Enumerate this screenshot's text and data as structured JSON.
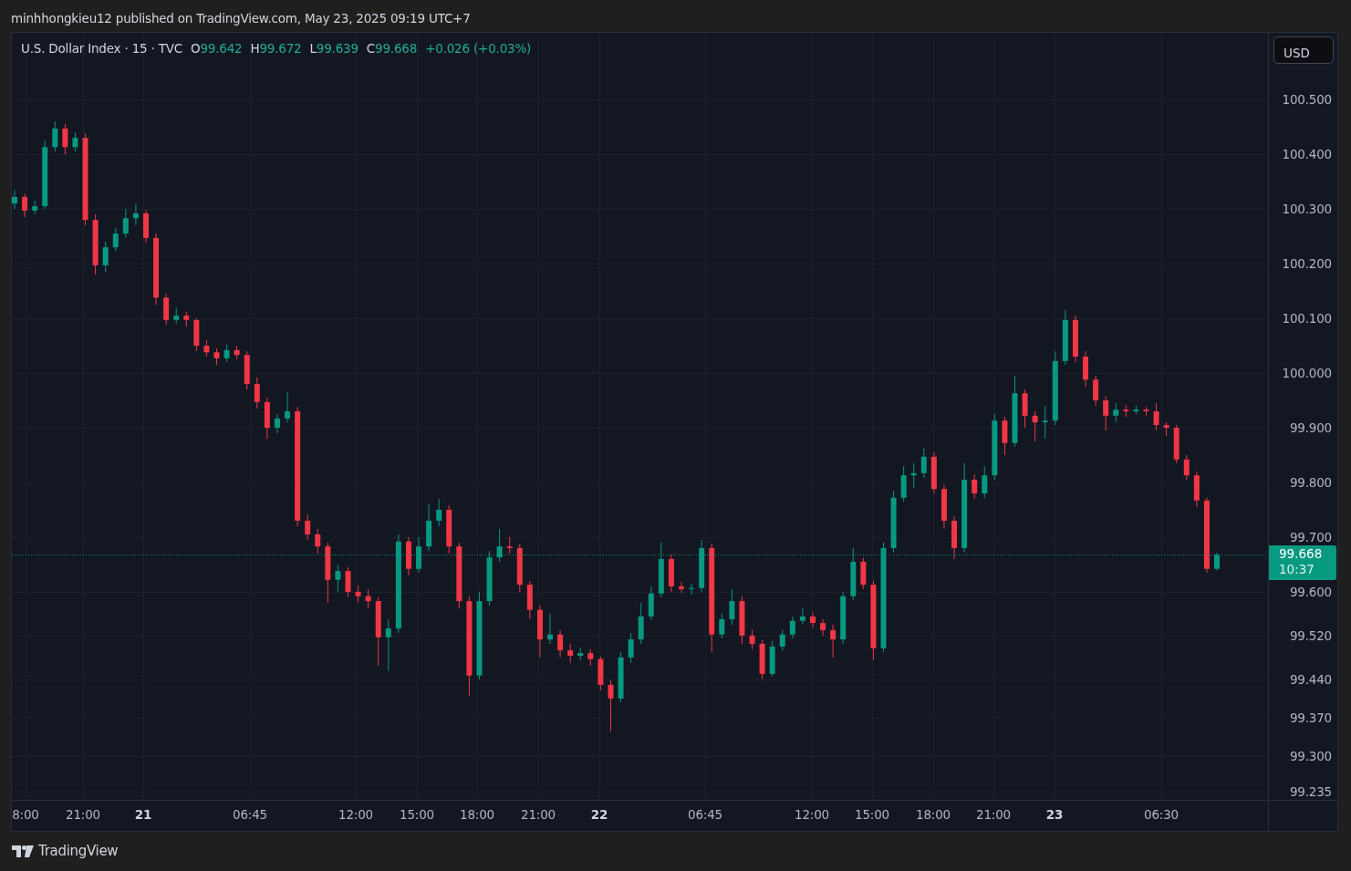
{
  "published_line": "minhhongkieu12 published on TradingView.com, May 23, 2025 09:19 UTC+7",
  "legend": {
    "symbol": "U.S. Dollar Index · 15 · TVC",
    "values": [
      {
        "label": "O",
        "value": "99.642"
      },
      {
        "label": "H",
        "value": "99.672"
      },
      {
        "label": "L",
        "value": "99.639"
      },
      {
        "label": "C",
        "value": "99.668"
      }
    ],
    "change": "+0.026 (+0.03%)"
  },
  "chart": {
    "chart_data": {
      "type": "candlestick",
      "grid": true,
      "ref_lines": [
        {
          "axis": "y",
          "value": 99.668
        }
      ],
      "ylim": [
        99.218,
        100.622
      ],
      "yticks": [
        {
          "value": 100.5,
          "label": "100.500"
        },
        {
          "value": 100.4,
          "label": "100.400"
        },
        {
          "value": 100.3,
          "label": "100.300"
        },
        {
          "value": 100.2,
          "label": "100.200"
        },
        {
          "value": 100.1,
          "label": "100.100"
        },
        {
          "value": 100.0,
          "label": "100.000"
        },
        {
          "value": 99.9,
          "label": "99.900"
        },
        {
          "value": 99.8,
          "label": "99.800"
        },
        {
          "value": 99.7,
          "label": "99.700"
        },
        {
          "value": 99.6,
          "label": "99.600"
        },
        {
          "value": 99.52,
          "label": "99.520"
        },
        {
          "value": 99.44,
          "label": "99.440"
        },
        {
          "value": 99.37,
          "label": "99.370"
        },
        {
          "value": 99.3,
          "label": "99.300"
        },
        {
          "value": 99.235,
          "label": "99.235"
        }
      ],
      "categories": [
        null,
        null,
        null,
        null,
        null,
        null,
        null,
        null,
        null,
        null,
        null,
        null,
        null,
        null,
        null,
        null,
        null,
        null,
        null,
        null,
        null,
        null,
        null,
        null,
        null,
        null,
        null,
        null,
        null,
        null,
        null,
        null,
        null,
        null,
        null,
        null,
        null,
        null,
        null,
        null,
        null,
        null,
        null,
        null,
        null,
        null,
        null,
        null,
        null,
        null,
        null,
        null,
        null,
        null,
        null,
        null,
        null,
        null,
        null,
        null,
        null,
        null,
        null,
        null,
        null,
        null,
        null,
        null,
        null,
        null,
        null,
        null,
        null,
        null,
        null,
        null,
        null,
        null,
        null,
        null,
        null,
        null,
        null,
        null,
        null,
        null,
        null,
        null,
        null,
        null,
        null,
        null,
        null,
        null,
        null,
        null,
        null,
        null,
        null,
        null,
        null,
        null,
        null,
        null,
        null,
        null,
        null,
        null,
        null,
        null,
        null,
        null,
        null,
        null,
        null,
        null,
        null,
        null,
        null,
        null
      ],
      "ohlc": [
        [
          100.31,
          100.334,
          100.3,
          100.322
        ],
        [
          100.322,
          100.328,
          100.285,
          100.297
        ],
        [
          100.297,
          100.315,
          100.29,
          100.305
        ],
        [
          100.305,
          100.425,
          100.3,
          100.413
        ],
        [
          100.413,
          100.46,
          100.405,
          100.447
        ],
        [
          100.447,
          100.455,
          100.4,
          100.413
        ],
        [
          100.413,
          100.44,
          100.405,
          100.43
        ],
        [
          100.43,
          100.438,
          100.27,
          100.28
        ],
        [
          100.28,
          100.29,
          100.18,
          100.197
        ],
        [
          100.197,
          100.24,
          100.185,
          100.23
        ],
        [
          100.23,
          100.265,
          100.222,
          100.255
        ],
        [
          100.255,
          100.3,
          100.248,
          100.283
        ],
        [
          100.283,
          100.31,
          100.27,
          100.292
        ],
        [
          100.292,
          100.298,
          100.238,
          100.247
        ],
        [
          100.247,
          100.255,
          100.125,
          100.138
        ],
        [
          100.138,
          100.145,
          100.088,
          100.097
        ],
        [
          100.097,
          100.12,
          100.09,
          100.105
        ],
        [
          100.105,
          100.112,
          100.085,
          100.097
        ],
        [
          100.097,
          100.1,
          100.04,
          100.05
        ],
        [
          100.05,
          100.06,
          100.03,
          100.038
        ],
        [
          100.038,
          100.045,
          100.015,
          100.027
        ],
        [
          100.027,
          100.052,
          100.02,
          100.042
        ],
        [
          100.042,
          100.05,
          100.025,
          100.033
        ],
        [
          100.033,
          100.04,
          99.97,
          99.98
        ],
        [
          99.98,
          99.992,
          99.935,
          99.947
        ],
        [
          99.947,
          99.955,
          99.88,
          99.9
        ],
        [
          99.9,
          99.925,
          99.89,
          99.917
        ],
        [
          99.917,
          99.965,
          99.91,
          99.93
        ],
        [
          99.93,
          99.938,
          99.72,
          99.73
        ],
        [
          99.73,
          99.742,
          99.695,
          99.705
        ],
        [
          99.705,
          99.715,
          99.67,
          99.683
        ],
        [
          99.683,
          99.69,
          99.58,
          99.622
        ],
        [
          99.622,
          99.65,
          99.6,
          99.638
        ],
        [
          99.638,
          99.645,
          99.59,
          99.6
        ],
        [
          99.6,
          99.612,
          99.58,
          99.592
        ],
        [
          99.592,
          99.605,
          99.57,
          99.583
        ],
        [
          99.583,
          99.59,
          99.465,
          99.517
        ],
        [
          99.517,
          99.55,
          99.455,
          99.533
        ],
        [
          99.533,
          99.705,
          99.525,
          99.692
        ],
        [
          99.692,
          99.7,
          99.63,
          99.642
        ],
        [
          99.642,
          99.7,
          99.635,
          99.683
        ],
        [
          99.683,
          99.76,
          99.675,
          99.73
        ],
        [
          99.73,
          99.77,
          99.72,
          99.75
        ],
        [
          99.75,
          99.758,
          99.67,
          99.683
        ],
        [
          99.683,
          99.69,
          99.57,
          99.583
        ],
        [
          99.583,
          99.592,
          99.41,
          99.447
        ],
        [
          99.447,
          99.6,
          99.44,
          99.583
        ],
        [
          99.583,
          99.675,
          99.575,
          99.663
        ],
        [
          99.663,
          99.715,
          99.655,
          99.683
        ],
        [
          99.683,
          99.7,
          99.67,
          99.68
        ],
        [
          99.68,
          99.688,
          99.6,
          99.613
        ],
        [
          99.613,
          99.62,
          99.55,
          99.567
        ],
        [
          99.567,
          99.575,
          99.48,
          99.513
        ],
        [
          99.513,
          99.56,
          99.505,
          99.522
        ],
        [
          99.522,
          99.53,
          99.48,
          99.493
        ],
        [
          99.493,
          99.505,
          99.47,
          99.483
        ],
        [
          99.483,
          99.498,
          99.475,
          99.488
        ],
        [
          99.488,
          99.495,
          99.465,
          99.477
        ],
        [
          99.477,
          99.482,
          99.42,
          99.43
        ],
        [
          99.43,
          99.438,
          99.345,
          99.405
        ],
        [
          99.405,
          99.49,
          99.398,
          99.48
        ],
        [
          99.48,
          99.525,
          99.47,
          99.513
        ],
        [
          99.513,
          99.58,
          99.505,
          99.555
        ],
        [
          99.555,
          99.61,
          99.548,
          99.597
        ],
        [
          99.597,
          99.69,
          99.59,
          99.66
        ],
        [
          99.66,
          99.668,
          99.6,
          99.61
        ],
        [
          99.61,
          99.618,
          99.598,
          99.605
        ],
        [
          99.605,
          99.615,
          99.595,
          99.607
        ],
        [
          99.607,
          99.695,
          99.6,
          99.68
        ],
        [
          99.68,
          99.688,
          99.49,
          99.522
        ],
        [
          99.522,
          99.56,
          99.515,
          99.55
        ],
        [
          99.55,
          99.605,
          99.54,
          99.583
        ],
        [
          99.583,
          99.592,
          99.505,
          99.52
        ],
        [
          99.52,
          99.53,
          99.495,
          99.505
        ],
        [
          99.505,
          99.512,
          99.44,
          99.45
        ],
        [
          99.45,
          99.51,
          99.445,
          99.5
        ],
        [
          99.5,
          99.53,
          99.492,
          99.522
        ],
        [
          99.522,
          99.555,
          99.515,
          99.547
        ],
        [
          99.547,
          99.57,
          99.54,
          99.555
        ],
        [
          99.555,
          99.562,
          99.535,
          99.543
        ],
        [
          99.543,
          99.55,
          99.52,
          99.53
        ],
        [
          99.53,
          99.54,
          99.48,
          99.513
        ],
        [
          99.513,
          99.6,
          99.505,
          99.592
        ],
        [
          99.592,
          99.68,
          99.585,
          99.655
        ],
        [
          99.655,
          99.662,
          99.605,
          99.613
        ],
        [
          99.613,
          99.62,
          99.475,
          99.497
        ],
        [
          99.497,
          99.69,
          99.49,
          99.68
        ],
        [
          99.68,
          99.785,
          99.672,
          99.772
        ],
        [
          99.772,
          99.83,
          99.765,
          99.813
        ],
        [
          99.813,
          99.835,
          99.79,
          99.817
        ],
        [
          99.817,
          99.862,
          99.808,
          99.847
        ],
        [
          99.847,
          99.855,
          99.78,
          99.788
        ],
        [
          99.788,
          99.795,
          99.715,
          99.73
        ],
        [
          99.73,
          99.738,
          99.66,
          99.68
        ],
        [
          99.68,
          99.835,
          99.672,
          99.805
        ],
        [
          99.805,
          99.815,
          99.77,
          99.78
        ],
        [
          99.78,
          99.83,
          99.772,
          99.813
        ],
        [
          99.813,
          99.925,
          99.805,
          99.913
        ],
        [
          99.913,
          99.92,
          99.85,
          99.872
        ],
        [
          99.872,
          99.995,
          99.865,
          99.963
        ],
        [
          99.963,
          99.97,
          99.9,
          99.922
        ],
        [
          99.922,
          99.93,
          99.875,
          99.91
        ],
        [
          99.91,
          99.94,
          99.88,
          99.913
        ],
        [
          99.913,
          100.04,
          99.905,
          100.022
        ],
        [
          100.022,
          100.115,
          100.015,
          100.097
        ],
        [
          100.097,
          100.105,
          100.02,
          100.03
        ],
        [
          100.03,
          100.04,
          99.975,
          99.988
        ],
        [
          99.988,
          99.995,
          99.94,
          99.95
        ],
        [
          99.95,
          99.958,
          99.895,
          99.922
        ],
        [
          99.922,
          99.945,
          99.91,
          99.933
        ],
        [
          99.933,
          99.942,
          99.92,
          99.93
        ],
        [
          99.93,
          99.94,
          99.925,
          99.933
        ],
        [
          99.933,
          99.938,
          99.922,
          99.93
        ],
        [
          99.93,
          99.945,
          99.895,
          99.905
        ],
        [
          99.905,
          99.91,
          99.885,
          99.9
        ],
        [
          99.9,
          99.905,
          99.835,
          99.842
        ],
        [
          99.842,
          99.85,
          99.805,
          99.813
        ],
        [
          99.813,
          99.82,
          99.755,
          99.767
        ],
        [
          99.767,
          99.772,
          99.635,
          99.642
        ],
        [
          99.642,
          99.672,
          99.639,
          99.668
        ]
      ]
    }
  },
  "time_axis": [
    {
      "label": "8:00",
      "kind": "time"
    },
    {
      "label": "21:00",
      "kind": "time"
    },
    {
      "label": "21",
      "kind": "day"
    },
    {
      "label": "06:45",
      "kind": "time"
    },
    {
      "label": "12:00",
      "kind": "time"
    },
    {
      "label": "15:00",
      "kind": "time"
    },
    {
      "label": "18:00",
      "kind": "time"
    },
    {
      "label": "21:00",
      "kind": "time"
    },
    {
      "label": "22",
      "kind": "day"
    },
    {
      "label": "06:45",
      "kind": "time"
    },
    {
      "label": "12:00",
      "kind": "time"
    },
    {
      "label": "15:00",
      "kind": "time"
    },
    {
      "label": "18:00",
      "kind": "time"
    },
    {
      "label": "21:00",
      "kind": "time"
    },
    {
      "label": "23",
      "kind": "day"
    },
    {
      "label": "06:30",
      "kind": "time"
    }
  ],
  "currency_button": "USD",
  "last_price": {
    "price": "99.668",
    "countdown": "10:37"
  },
  "footer": {
    "logo_text": "TradingView"
  }
}
